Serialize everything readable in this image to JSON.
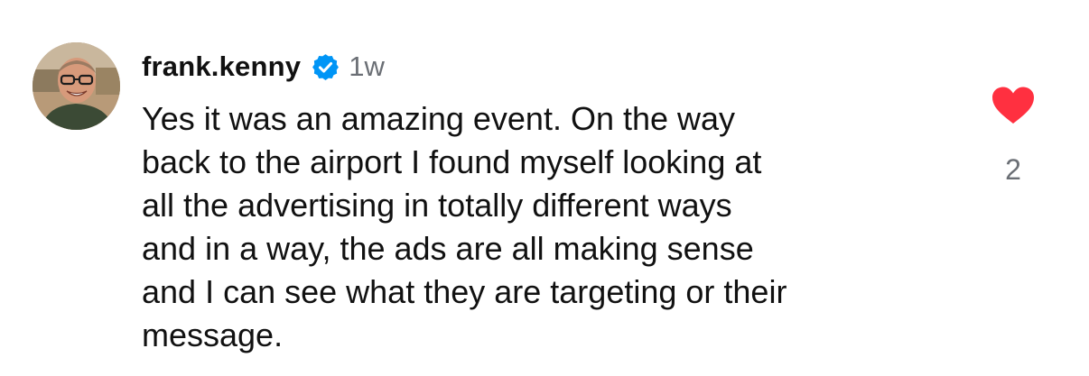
{
  "comment": {
    "username": "frank.kenny",
    "verified": true,
    "time_ago": "1w",
    "lines": [
      "Yes it was an amazing event. On the way",
      "back to the airport I found myself looking at",
      "all the advertising in totally different ways",
      "and in a way, the ads are all making sense",
      "and I can see what they are targeting or their",
      "message."
    ],
    "liked": true,
    "like_count": "2"
  },
  "icons": {
    "verified": "verified-badge-icon",
    "like": "heart-icon"
  },
  "colors": {
    "verified_blue": "#0095F6",
    "heart_red": "#FF3040",
    "muted_text": "#6B6F75"
  }
}
